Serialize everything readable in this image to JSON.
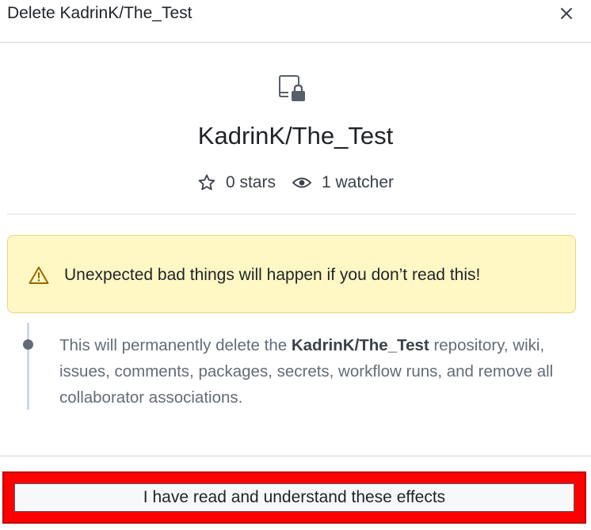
{
  "dialog": {
    "title": "Delete KadrinK/The_Test",
    "close_icon": "x-icon"
  },
  "repo": {
    "icon": "repo-locked-icon",
    "name": "KadrinK/The_Test",
    "stars_icon": "star-icon",
    "stars_label": "0 stars",
    "watchers_icon": "eye-icon",
    "watchers_label": "1 watcher"
  },
  "warning": {
    "icon": "alert-icon",
    "text": "Unexpected bad things will happen if you don’t read this!"
  },
  "effects": {
    "prefix": "This will permanently delete the ",
    "repo_name": "KadrinK/The_Test",
    "suffix": " repository, wiki, issues, comments, packages, secrets, workflow runs, and remove all collaborator associations."
  },
  "footer": {
    "confirm_label": "I have read and understand these effects"
  },
  "colors": {
    "warning_bg": "#fff8c5",
    "warning_border": "#e6d483",
    "highlight": "#ff0000",
    "muted_text": "#636c76"
  }
}
